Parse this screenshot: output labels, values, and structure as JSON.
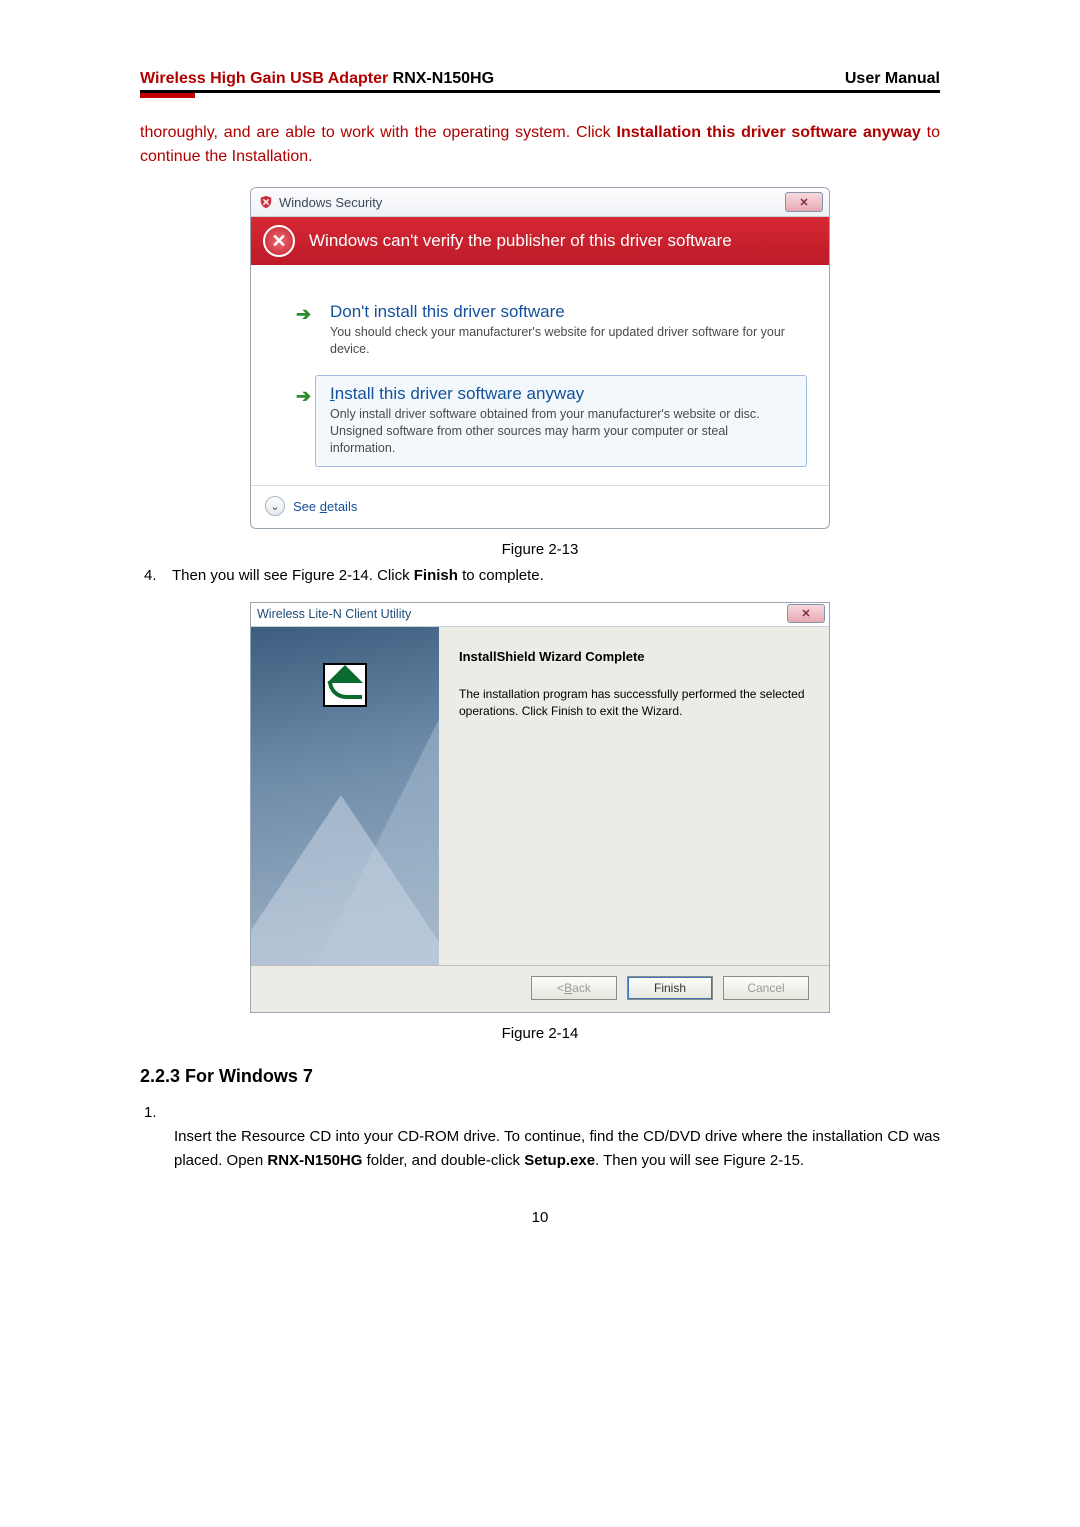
{
  "header": {
    "product_red": "Wireless High Gain USB Adapter",
    "product_model": " RNX-N150HG",
    "right": "User Manual"
  },
  "intro_text": "thoroughly, and are able to work with the operating system. Click ",
  "intro_bold1": "Installation this driver software anyway",
  "intro_tail": " to continue the Installation.",
  "dialog1": {
    "title": "Windows Security",
    "warning": "Windows can't verify the publisher of this driver software",
    "opt1_title": "Don't install this driver software",
    "opt1_desc": "You should check your manufacturer's website for updated driver software for your device.",
    "opt2_title": "Install this driver software anyway",
    "opt2_desc": "Only install driver software obtained from your manufacturer's website or disc. Unsigned software from other sources may harm your computer or steal information.",
    "see_details": "See details"
  },
  "fig1_caption": "Figure 2-13",
  "step4_num": "4.",
  "step4_text_a": "Then you will see Figure 2-14. Click ",
  "step4_bold": "Finish",
  "step4_text_b": " to complete.",
  "dialog2": {
    "title": "Wireless Lite-N Client Utility",
    "heading": "InstallShield Wizard Complete",
    "body": "The installation program has successfully performed the selected operations.  Click Finish to exit the Wizard.",
    "btn_back": "< Back",
    "btn_finish": "Finish",
    "btn_cancel": "Cancel"
  },
  "fig2_caption": "Figure 2-14",
  "section_heading": "2.2.3  For Windows 7",
  "step1_num": "1.",
  "step1_a": "Insert the Resource CD into your CD-ROM drive. To continue, find the CD/DVD drive where the installation CD was placed. Open ",
  "step1_bold1": "RNX-N150HG",
  "step1_b": " folder, and double-click ",
  "step1_bold2": "Setup.exe",
  "step1_c": ". Then you will see Figure 2-15.",
  "page_number": "10"
}
